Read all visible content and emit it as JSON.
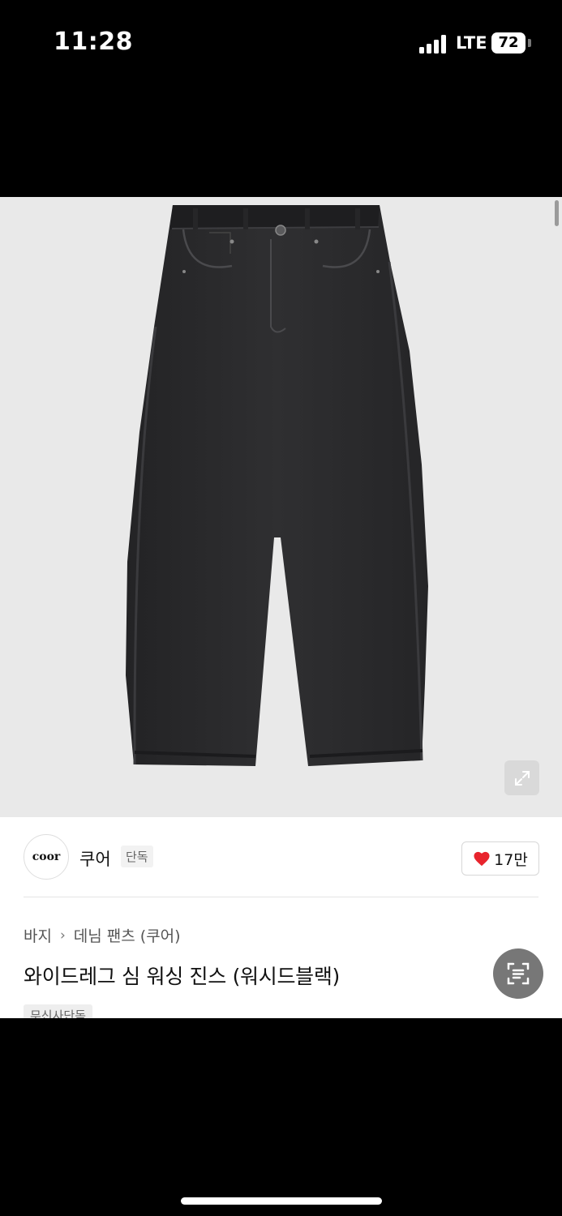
{
  "status_bar": {
    "time": "11:28",
    "network": "LTE",
    "battery": "72"
  },
  "brand": {
    "logo_text": "coor",
    "name": "쿠어",
    "badge": "단독"
  },
  "likes": {
    "count": "17만"
  },
  "breadcrumb": {
    "category": "바지",
    "subcategory": "데님 팬츠 (쿠어)"
  },
  "product": {
    "title": "와이드레그 심 워싱 진스 (워시드블랙)",
    "tag": "무신사단독"
  },
  "colors": {
    "like_heart": "#e8242d",
    "image_bg": "#e9e9e9",
    "denim": "#2b2b2d"
  }
}
